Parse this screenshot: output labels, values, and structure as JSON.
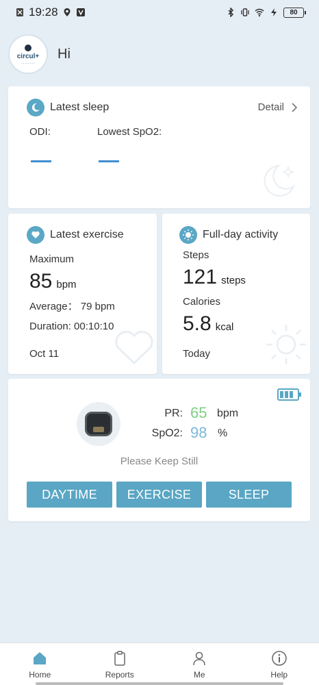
{
  "status_bar": {
    "time": "19:28",
    "battery": "80"
  },
  "header": {
    "greeting": "Hi",
    "avatar_text": "circul+"
  },
  "latest_sleep": {
    "title": "Latest sleep",
    "detail_label": "Detail",
    "odi_label": "ODI:",
    "lowest_spo2_label": "Lowest SpO2:"
  },
  "latest_exercise": {
    "title": "Latest exercise",
    "maximum_label": "Maximum",
    "maximum_value": "85",
    "maximum_unit": "bpm",
    "average_text": "Average： 79 bpm",
    "duration_text": "Duration: 00:10:10",
    "date": "Oct 11"
  },
  "full_day_activity": {
    "title": "Full-day activity",
    "steps_label": "Steps",
    "steps_value": "121",
    "steps_unit": "steps",
    "calories_label": "Calories",
    "calories_value": "5.8",
    "calories_unit": "kcal",
    "period": "Today"
  },
  "device": {
    "pr_label": "PR:",
    "pr_value": "65",
    "pr_unit": "bpm",
    "spo2_label": "SpO2:",
    "spo2_value": "98",
    "spo2_unit": "%",
    "status_text": "Please Keep Still",
    "modes": [
      "DAYTIME",
      "EXERCISE",
      "SLEEP"
    ],
    "pr_color": "#7fcf86",
    "spo2_color": "#7cb8d8"
  },
  "bottom_nav": [
    {
      "label": "Home",
      "icon": "home-icon",
      "active": true
    },
    {
      "label": "Reports",
      "icon": "clipboard-icon",
      "active": false
    },
    {
      "label": "Me",
      "icon": "person-icon",
      "active": false
    },
    {
      "label": "Help",
      "icon": "info-icon",
      "active": false
    }
  ],
  "colors": {
    "accent": "#5aa6c4",
    "background": "#e6eef5"
  }
}
